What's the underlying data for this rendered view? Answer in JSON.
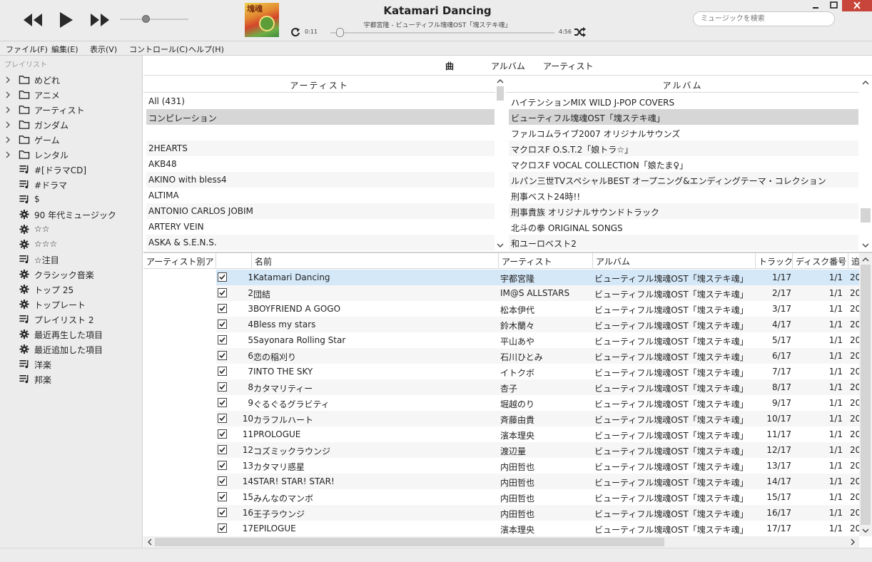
{
  "toolbar": {
    "rewind_icon": "rewind-icon",
    "play_icon": "play-icon",
    "forward_icon": "fast-forward-icon",
    "volume_level": 0.38,
    "album_art_text": "塊魂",
    "now_playing_title": "Katamari Dancing",
    "now_playing_subtitle": "宇都宮隆 - ビューティフル塊魂OST「塊ステキ魂」",
    "time_current": "0:11",
    "time_total": "4:56",
    "seek_progress": 0.04,
    "search_placeholder": "ミュージックを検索"
  },
  "menu": [
    "ファイル(F)",
    "編集(E)",
    "表示(V)",
    "コントロール(C)",
    "ヘルプ(H)"
  ],
  "sidebar": {
    "header": "プレイリスト",
    "items": [
      {
        "label": "めどれ",
        "icon": "folder-icon",
        "folder": true
      },
      {
        "label": "アニメ",
        "icon": "folder-icon",
        "folder": true
      },
      {
        "label": "アーティスト",
        "icon": "folder-icon",
        "folder": true
      },
      {
        "label": "ガンダム",
        "icon": "folder-icon",
        "folder": true
      },
      {
        "label": "ゲーム",
        "icon": "folder-icon",
        "folder": true
      },
      {
        "label": "レンタル",
        "icon": "folder-icon",
        "folder": true
      },
      {
        "label": "#[ドラマCD]",
        "icon": "playlist-icon",
        "folder": false
      },
      {
        "label": "#ドラマ",
        "icon": "playlist-icon",
        "folder": false
      },
      {
        "label": "$",
        "icon": "playlist-icon",
        "folder": false
      },
      {
        "label": "90 年代ミュージック",
        "icon": "gear-icon",
        "folder": false
      },
      {
        "label": "☆☆",
        "icon": "gear-icon",
        "folder": false
      },
      {
        "label": "☆☆☆",
        "icon": "gear-icon",
        "folder": false
      },
      {
        "label": "☆注目",
        "icon": "playlist-icon",
        "folder": false
      },
      {
        "label": "クラシック音楽",
        "icon": "gear-icon",
        "folder": false
      },
      {
        "label": "トップ 25",
        "icon": "gear-icon",
        "folder": false
      },
      {
        "label": "トップレート",
        "icon": "gear-icon",
        "folder": false
      },
      {
        "label": "プレイリスト 2",
        "icon": "playlist-icon",
        "folder": false
      },
      {
        "label": "最近再生した項目",
        "icon": "gear-icon",
        "folder": false
      },
      {
        "label": "最近追加した項目",
        "icon": "gear-icon",
        "folder": false
      },
      {
        "label": "洋楽",
        "icon": "playlist-icon",
        "folder": false
      },
      {
        "label": "邦楽",
        "icon": "playlist-icon",
        "folder": false
      }
    ]
  },
  "view_tabs": {
    "songs": "曲",
    "albums": "アルバム",
    "artists": "アーティスト"
  },
  "artist_browser": {
    "header": "アーティスト",
    "rows": [
      "All (431)",
      "コンピレーション",
      "",
      "2HEARTS",
      "AKB48",
      "AKINO with bless4",
      "ALTIMA",
      "ANTONIO CARLOS JOBIM",
      "ARTERY VEIN",
      "ASKA & S.E.N.S."
    ],
    "selected": 1
  },
  "album_browser": {
    "header": "アルバム",
    "rows": [
      "ハイテンションMIX WILD J-POP COVERS",
      "ビューティフル塊魂OST「塊ステキ魂」",
      "ファルコムライブ2007 オリジナルサウンズ",
      "マクロスF O.S.T.2「娘トラ☆」",
      "マクロスF VOCAL COLLECTION「娘たま♀」",
      "ルパン三世TVスペシャルBEST オープニング&エンディングテーマ・コレクション",
      "刑事ベスト24時!!",
      "刑事貴族 オリジナルサウンドトラック",
      "北斗の拳 ORIGINAL SONGS",
      "和ユーロベスト2"
    ],
    "selected": 1
  },
  "track_table": {
    "columns": {
      "artist_sort": "アーティスト別ア",
      "name": "名前",
      "artist": "アーティスト",
      "album": "アルバム",
      "track": "トラック",
      "disc": "ディスク番号",
      "extra": "追"
    },
    "rows": [
      {
        "num": "1",
        "name": "Katamari Dancing",
        "artist": "宇都宮隆",
        "album": "ビューティフル塊魂OST「塊ステキ魂」",
        "track": "1/17",
        "disc": "1/1",
        "extra": "20"
      },
      {
        "num": "2",
        "name": "団結",
        "artist": "IM@S ALLSTARS",
        "album": "ビューティフル塊魂OST「塊ステキ魂」",
        "track": "2/17",
        "disc": "1/1",
        "extra": "20"
      },
      {
        "num": "3",
        "name": "BOYFRIEND A GOGO",
        "artist": "松本伊代",
        "album": "ビューティフル塊魂OST「塊ステキ魂」",
        "track": "3/17",
        "disc": "1/1",
        "extra": "20"
      },
      {
        "num": "4",
        "name": "Bless my stars",
        "artist": "鈴木蘭々",
        "album": "ビューティフル塊魂OST「塊ステキ魂」",
        "track": "4/17",
        "disc": "1/1",
        "extra": "20"
      },
      {
        "num": "5",
        "name": "Sayonara Rolling Star",
        "artist": "平山あや",
        "album": "ビューティフル塊魂OST「塊ステキ魂」",
        "track": "5/17",
        "disc": "1/1",
        "extra": "20"
      },
      {
        "num": "6",
        "name": "恋の稲刈り",
        "artist": "石川ひとみ",
        "album": "ビューティフル塊魂OST「塊ステキ魂」",
        "track": "6/17",
        "disc": "1/1",
        "extra": "20"
      },
      {
        "num": "7",
        "name": "INTO THE SKY",
        "artist": "イトクボ",
        "album": "ビューティフル塊魂OST「塊ステキ魂」",
        "track": "7/17",
        "disc": "1/1",
        "extra": "20"
      },
      {
        "num": "8",
        "name": "カタマリティー",
        "artist": "杏子",
        "album": "ビューティフル塊魂OST「塊ステキ魂」",
        "track": "8/17",
        "disc": "1/1",
        "extra": "20"
      },
      {
        "num": "9",
        "name": "ぐるぐるグラビティ",
        "artist": "堀越のり",
        "album": "ビューティフル塊魂OST「塊ステキ魂」",
        "track": "9/17",
        "disc": "1/1",
        "extra": "20"
      },
      {
        "num": "10",
        "name": "カラフルハート",
        "artist": "斉藤由貴",
        "album": "ビューティフル塊魂OST「塊ステキ魂」",
        "track": "10/17",
        "disc": "1/1",
        "extra": "20"
      },
      {
        "num": "11",
        "name": "PROLOGUE",
        "artist": "濱本理央",
        "album": "ビューティフル塊魂OST「塊ステキ魂」",
        "track": "11/17",
        "disc": "1/1",
        "extra": "20"
      },
      {
        "num": "12",
        "name": "コズミックラウンジ",
        "artist": "渡辺量",
        "album": "ビューティフル塊魂OST「塊ステキ魂」",
        "track": "12/17",
        "disc": "1/1",
        "extra": "20"
      },
      {
        "num": "13",
        "name": "カタマリ惑星",
        "artist": "内田哲也",
        "album": "ビューティフル塊魂OST「塊ステキ魂」",
        "track": "13/17",
        "disc": "1/1",
        "extra": "20"
      },
      {
        "num": "14",
        "name": "STAR! STAR! STAR!",
        "artist": "内田哲也",
        "album": "ビューティフル塊魂OST「塊ステキ魂」",
        "track": "14/17",
        "disc": "1/1",
        "extra": "20"
      },
      {
        "num": "15",
        "name": "みんなのマンボ",
        "artist": "内田哲也",
        "album": "ビューティフル塊魂OST「塊ステキ魂」",
        "track": "15/17",
        "disc": "1/1",
        "extra": "20"
      },
      {
        "num": "16",
        "name": "王子ラウンジ",
        "artist": "内田哲也",
        "album": "ビューティフル塊魂OST「塊ステキ魂」",
        "track": "16/17",
        "disc": "1/1",
        "extra": "20"
      },
      {
        "num": "17",
        "name": "EPILOGUE",
        "artist": "濱本理央",
        "album": "ビューティフル塊魂OST「塊ステキ魂」",
        "track": "17/17",
        "disc": "1/1",
        "extra": "20"
      }
    ],
    "selected": 0
  }
}
